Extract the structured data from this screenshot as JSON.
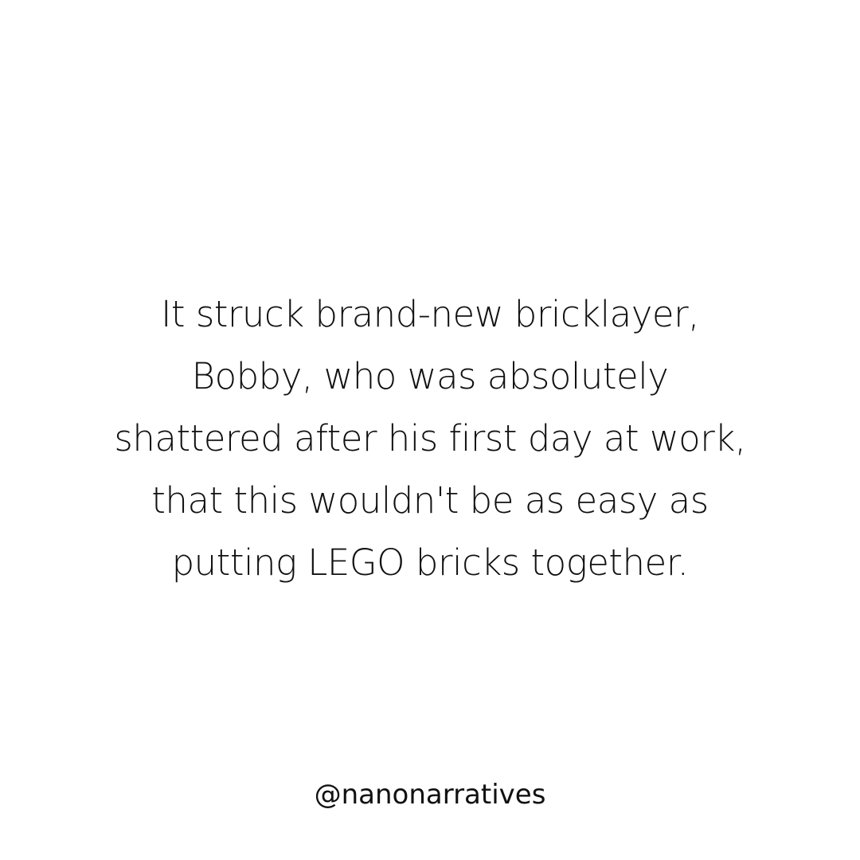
{
  "story": {
    "lines": [
      "It struck brand-new bricklayer,",
      "Bobby, who was absolutely",
      "shattered after his first day at work,",
      "that this wouldn't be as easy as",
      "putting LEGO bricks together."
    ]
  },
  "footer": {
    "handle": "@nanonarratives"
  },
  "colors": {
    "background": "#ffffff",
    "text": "#111111"
  }
}
